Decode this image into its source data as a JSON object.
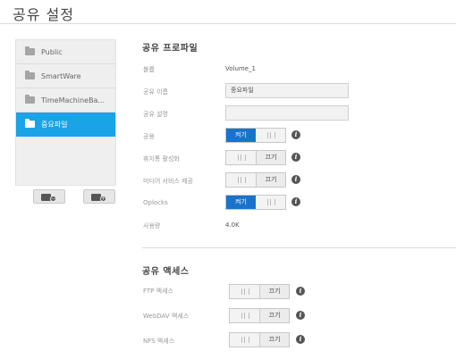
{
  "page": {
    "title": "공유 설정"
  },
  "share_list": {
    "items": [
      {
        "label": "Public",
        "active": false
      },
      {
        "label": "SmartWare",
        "active": false
      },
      {
        "label": "TimeMachineBa...",
        "active": false
      },
      {
        "label": "중요파일",
        "active": true
      }
    ],
    "remove_button_icon": "folder-minus-icon",
    "add_button_icon": "folder-plus-icon",
    "remove_symbol": "−",
    "add_symbol": "+"
  },
  "profile": {
    "heading": "공유 프로파일",
    "volume": {
      "label": "볼륨",
      "value": "Volume_1"
    },
    "share_name": {
      "label": "공유 이름",
      "value": "중요파일"
    },
    "share_description": {
      "label": "공유 설명",
      "value": ""
    },
    "public": {
      "label": "공용",
      "state": "on",
      "on_text": "켜기"
    },
    "recycle_bin": {
      "label": "휴지통 활성화",
      "state": "off",
      "off_text": "끄기"
    },
    "media_service": {
      "label": "미디어 서비스 제공",
      "state": "off",
      "off_text": "끄기"
    },
    "oplocks": {
      "label": "Oplocks",
      "state": "on",
      "on_text": "켜기"
    },
    "usage": {
      "label": "사용량",
      "value": "4.0K"
    }
  },
  "access": {
    "heading": "공유 액세스",
    "ftp": {
      "label": "FTP 액세스",
      "state": "off",
      "off_text": "끄기"
    },
    "webdav": {
      "label": "WebDAV 액세스",
      "state": "off",
      "off_text": "끄기"
    },
    "nfs": {
      "label": "NFS 액세스",
      "state": "off",
      "off_text": "끄기"
    }
  },
  "info_glyph": "i",
  "colors": {
    "accent": "#1aa3e6",
    "toggle_on": "#1a73c9",
    "text": "#555555",
    "muted": "#999999"
  }
}
